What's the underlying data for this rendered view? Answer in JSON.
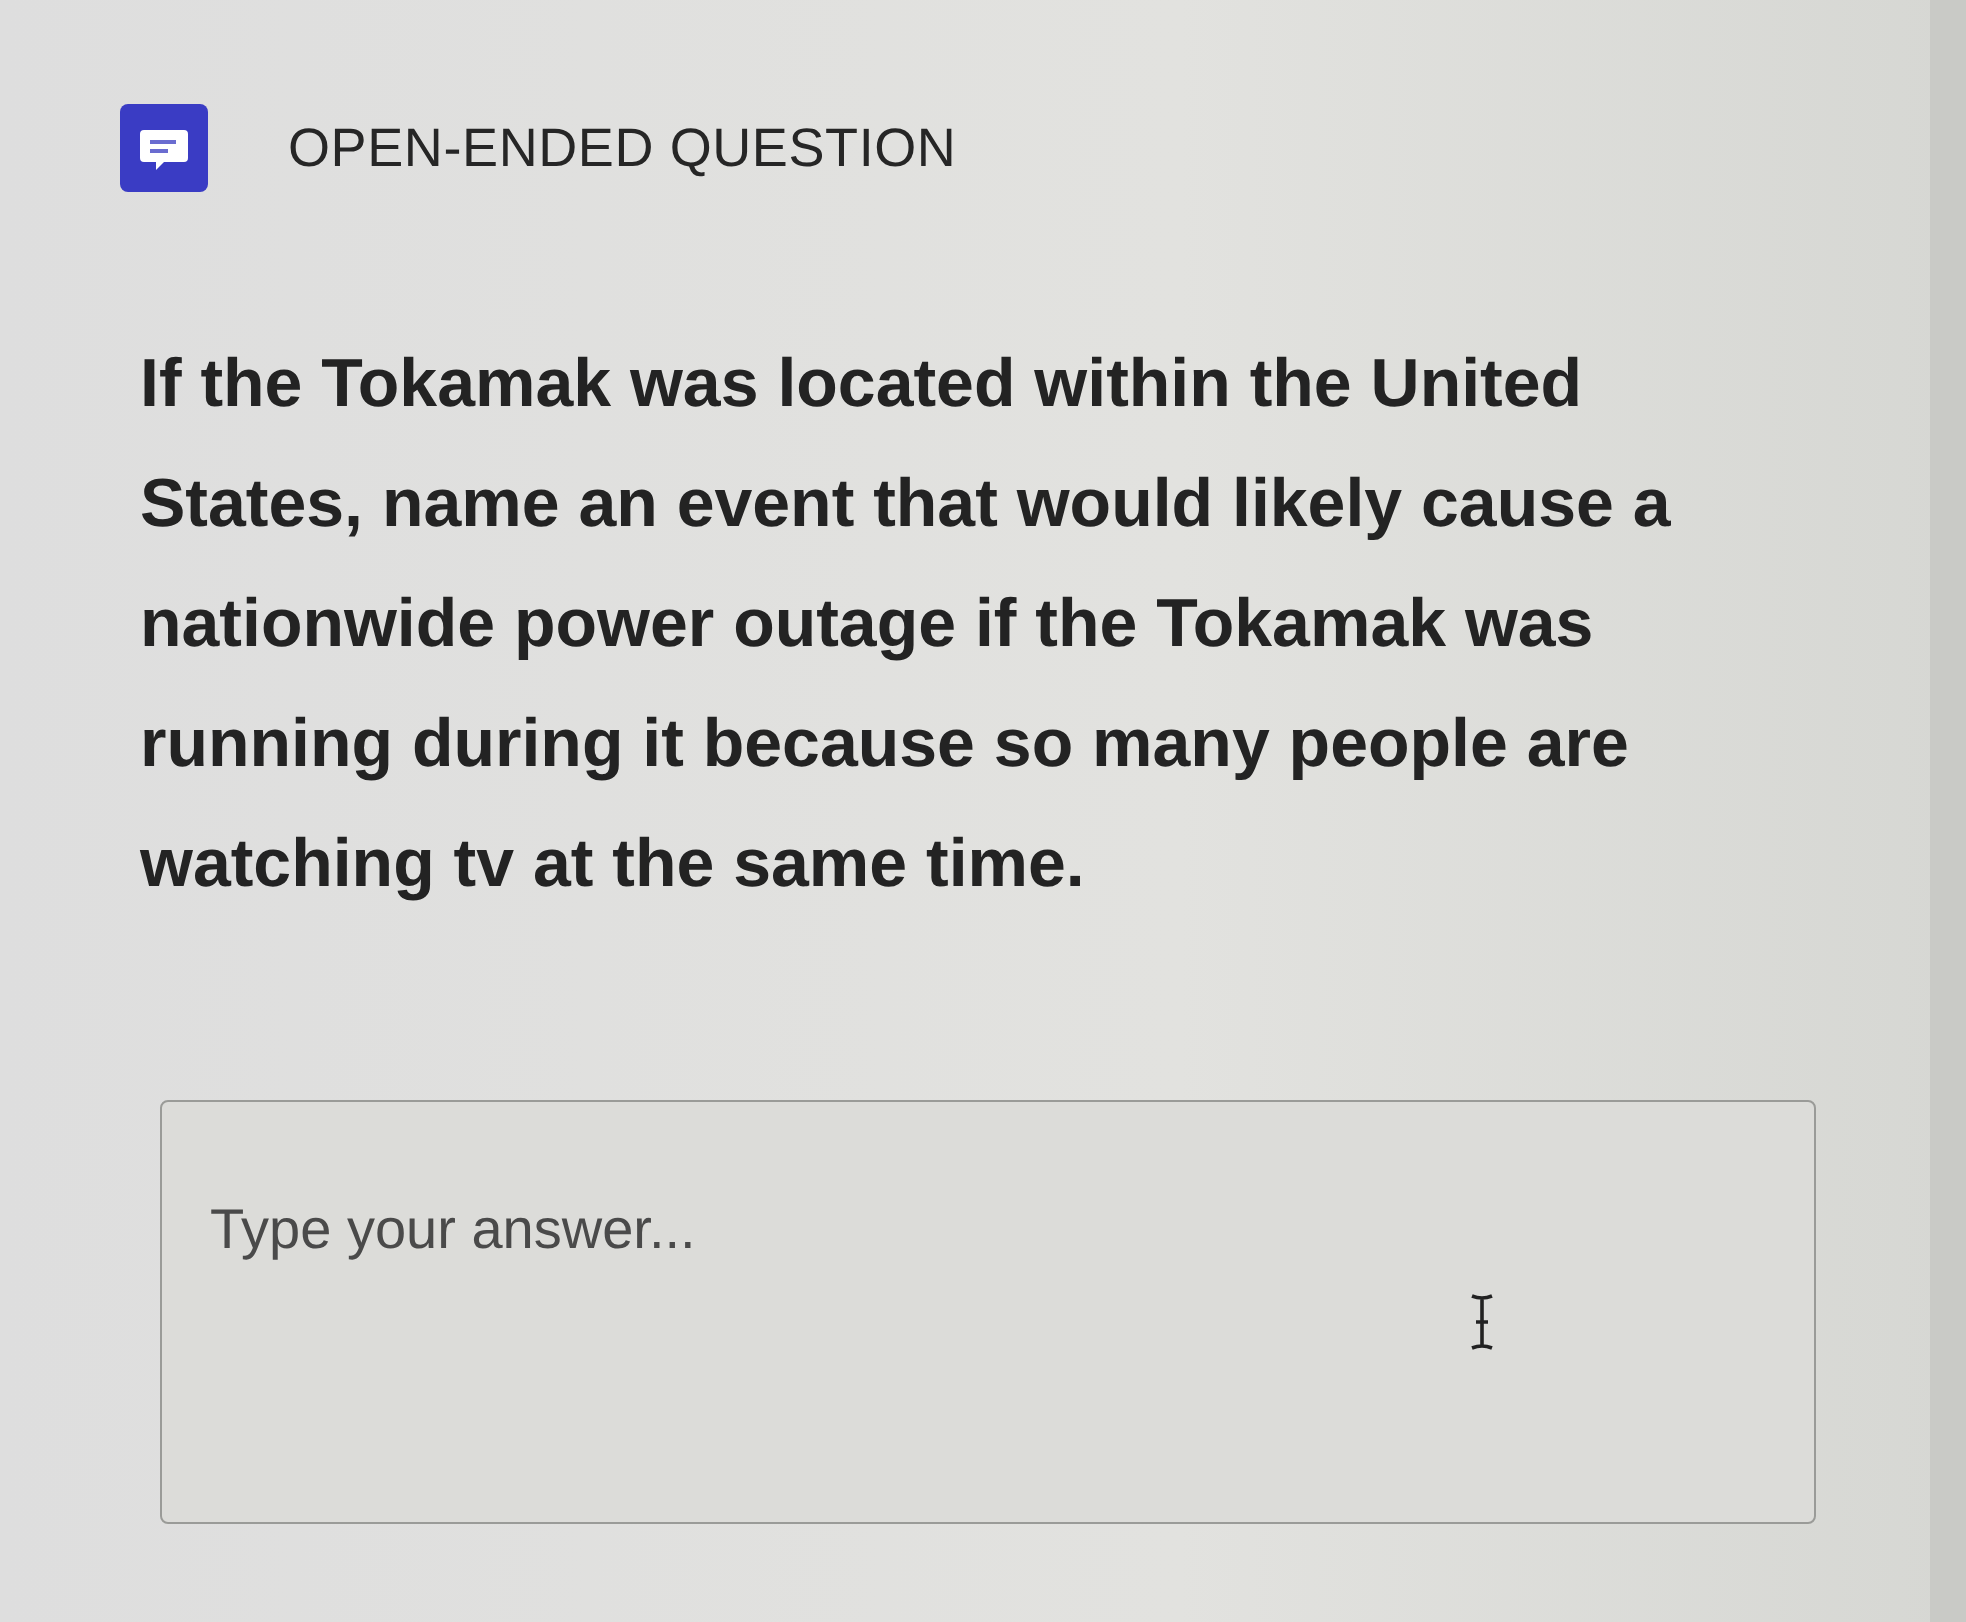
{
  "question": {
    "type_label": "OPEN-ENDED QUESTION",
    "text": "If the Tokamak was located within the United States, name an event that would likely cause a nationwide power outage if the Tokamak was running during it because so many people are watching tv at the same time."
  },
  "answer": {
    "placeholder": "Type your answer..."
  }
}
